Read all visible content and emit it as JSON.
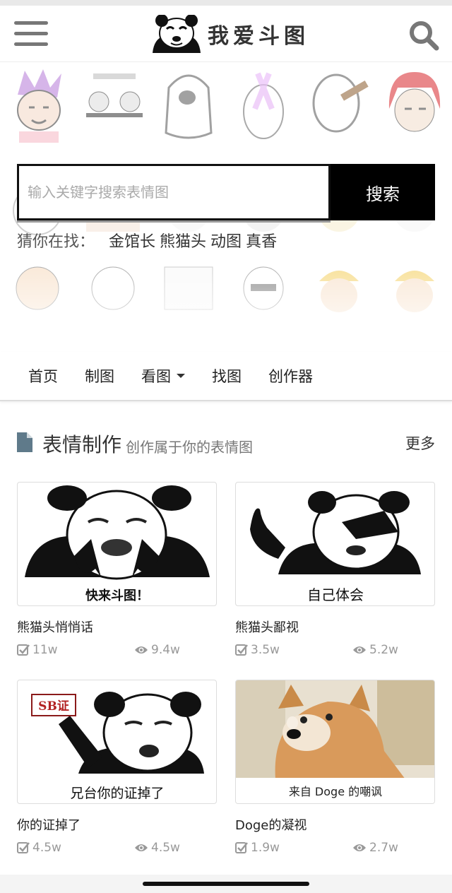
{
  "header": {
    "site_name": "我爱斗图",
    "menu_icon": "hamburger-menu-icon",
    "search_icon": "magnifier-icon"
  },
  "hero": {
    "search_placeholder": "输入关键字搜索表情图",
    "search_button": "搜索",
    "guess_label": "猜你在找：",
    "keywords": [
      "金馆长",
      "熊猫头",
      "动图",
      "真香"
    ]
  },
  "nav": {
    "items": [
      "首页",
      "制图",
      "看图",
      "找图",
      "创作器"
    ]
  },
  "section": {
    "title": "表情制作",
    "subtitle": "创作属于你的表情图",
    "more": "更多",
    "icon": "document-icon"
  },
  "cards": [
    {
      "title": "熊猫头悄悄话",
      "caption": "快来斗图！",
      "likes": "11w",
      "views": "9.4w"
    },
    {
      "title": "熊猫头鄙视",
      "caption": "自己体会",
      "likes": "3.5w",
      "views": "5.2w"
    },
    {
      "title": "你的证掉了",
      "caption": "兄台你的证掉了",
      "badge": "SB证",
      "likes": "4.5w",
      "views": "4.5w"
    },
    {
      "title": "Doge的凝视",
      "caption": "来自 Doge 的嘲讽",
      "likes": "1.9w",
      "views": "2.7w"
    }
  ],
  "colors": {
    "accent": "#000000",
    "icon_gray": "#777777",
    "doc_icon": "#5f7a8a",
    "stat_gray": "#999999"
  }
}
